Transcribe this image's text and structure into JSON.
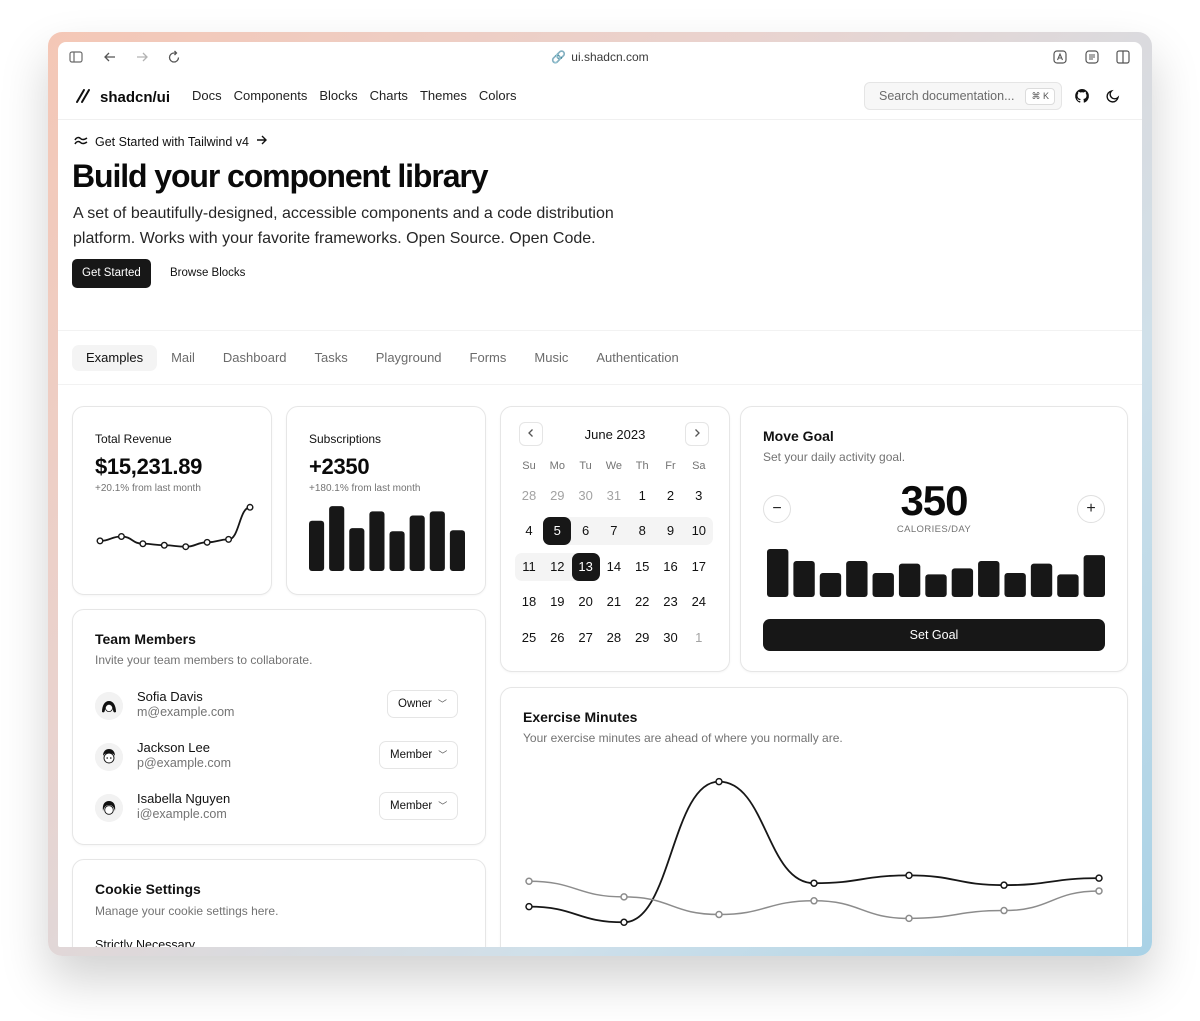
{
  "browser": {
    "url": "ui.shadcn.com"
  },
  "header": {
    "logo": "shadcn/ui",
    "nav": [
      "Docs",
      "Components",
      "Blocks",
      "Charts",
      "Themes",
      "Colors"
    ],
    "search_placeholder": "Search documentation...",
    "search_shortcut": "⌘ K"
  },
  "hero": {
    "announcement": "Get Started with Tailwind v4",
    "title": "Build your component library",
    "subtitle": "A set of beautifully-designed, accessible components and a code distribution platform. Works with your favorite frameworks. Open Source. Open Code.",
    "primary_button": "Get Started",
    "secondary_button": "Browse Blocks"
  },
  "tabs": {
    "items": [
      "Examples",
      "Mail",
      "Dashboard",
      "Tasks",
      "Playground",
      "Forms",
      "Music",
      "Authentication"
    ],
    "active": "Examples"
  },
  "revenue": {
    "label": "Total Revenue",
    "value": "$15,231.89",
    "change": "+20.1% from last month"
  },
  "subscriptions": {
    "label": "Subscriptions",
    "value": "+2350",
    "change": "+180.1% from last month"
  },
  "calendar": {
    "month": "June 2023",
    "weekdays": [
      "Su",
      "Mo",
      "Tu",
      "We",
      "Th",
      "Fr",
      "Sa"
    ],
    "weeks": [
      [
        "28",
        "29",
        "30",
        "31",
        "1",
        "2",
        "3"
      ],
      [
        "4",
        "5",
        "6",
        "7",
        "8",
        "9",
        "10"
      ],
      [
        "11",
        "12",
        "13",
        "14",
        "15",
        "16",
        "17"
      ],
      [
        "18",
        "19",
        "20",
        "21",
        "22",
        "23",
        "24"
      ],
      [
        "25",
        "26",
        "27",
        "28",
        "29",
        "30",
        "1"
      ]
    ],
    "selected_start": "5",
    "selected_end": "13"
  },
  "move_goal": {
    "title": "Move Goal",
    "description": "Set your daily activity goal.",
    "value": "350",
    "unit": "CALORIES/DAY",
    "button": "Set Goal",
    "decrease_symbol": "−",
    "increase_symbol": "+"
  },
  "team": {
    "title": "Team Members",
    "description": "Invite your team members to collaborate.",
    "members": [
      {
        "name": "Sofia Davis",
        "email": "m@example.com",
        "role": "Owner"
      },
      {
        "name": "Jackson Lee",
        "email": "p@example.com",
        "role": "Member"
      },
      {
        "name": "Isabella Nguyen",
        "email": "i@example.com",
        "role": "Member"
      }
    ]
  },
  "cookies": {
    "title": "Cookie Settings",
    "description": "Manage your cookie settings here.",
    "first_item": "Strictly Necessary"
  },
  "exercise": {
    "title": "Exercise Minutes",
    "description": "Your exercise minutes are ahead of where you normally are."
  },
  "chart_data": [
    {
      "type": "line",
      "name": "revenue-sparkline",
      "series": [
        {
          "values": [
            10400,
            10700,
            10200,
            10100,
            10000,
            10300,
            10500,
            12700
          ]
        }
      ],
      "ylim": [
        9500,
        13200
      ],
      "grid": false
    },
    {
      "type": "bar",
      "name": "subscriptions-bars",
      "values": [
        48,
        62,
        41,
        57,
        38,
        53,
        57,
        39
      ],
      "ylim": [
        0,
        65
      ],
      "grid": false
    },
    {
      "type": "bar",
      "name": "move-goal-bars",
      "values": [
        400,
        300,
        200,
        300,
        200,
        278,
        189,
        239,
        300,
        200,
        278,
        189,
        349
      ],
      "ylim": [
        0,
        400
      ],
      "grid": false
    },
    {
      "type": "line",
      "name": "exercise-minutes",
      "categories": [
        "1",
        "2",
        "3",
        "4",
        "5",
        "6",
        "7"
      ],
      "series": [
        {
          "values": [
            240,
            200,
            560,
            300,
            320,
            295,
            313
          ],
          "color": "#171717"
        },
        {
          "values": [
            305,
            265,
            220,
            255,
            210,
            230,
            280
          ],
          "color": "#8c8c8c"
        }
      ],
      "ylim": [
        170,
        600
      ],
      "grid": false
    }
  ]
}
